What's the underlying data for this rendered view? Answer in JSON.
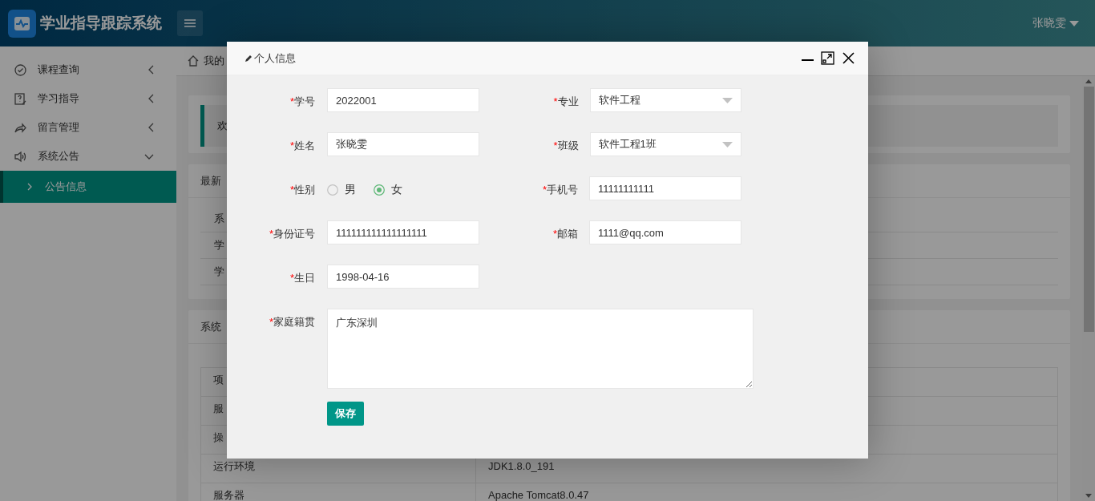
{
  "header": {
    "title": "学业指导跟踪系统",
    "user_name": "张晓雯"
  },
  "sidebar": {
    "items": [
      {
        "label": "课程查询",
        "expanded": false
      },
      {
        "label": "学习指导",
        "expanded": false
      },
      {
        "label": "留言管理",
        "expanded": false
      },
      {
        "label": "系统公告",
        "expanded": true,
        "children": [
          {
            "label": "公告信息",
            "selected": true
          }
        ]
      }
    ]
  },
  "breadcrumb": "我的",
  "welcome": "欢",
  "notices": {
    "title": "最新",
    "rows": [
      "系",
      "学",
      "学"
    ]
  },
  "system_info": {
    "title": "系统",
    "rows": [
      {
        "name": "项"
      },
      {
        "name": "服"
      },
      {
        "name": "操"
      },
      {
        "name": "运行环境",
        "value": "JDK1.8.0_191"
      },
      {
        "name": "服务器",
        "value": "Apache Tomcat8.0.47"
      }
    ]
  },
  "modal": {
    "title": "个人信息",
    "rows": [
      [
        {
          "kind": "text",
          "required_mark": "*",
          "label": "学号",
          "value": "2022001"
        },
        {
          "kind": "select",
          "required_mark": "*",
          "label": "专业",
          "value": "软件工程"
        }
      ],
      [
        {
          "kind": "text",
          "required_mark": "*",
          "label": "姓名",
          "value": "张晓雯"
        },
        {
          "kind": "select",
          "required_mark": "*",
          "label": "班级",
          "value": "软件工程1班"
        }
      ],
      [
        {
          "kind": "radio",
          "required_mark": "*",
          "label": "性别",
          "options": [
            {
              "label": "男",
              "selected": false
            },
            {
              "label": "女",
              "selected": true
            }
          ]
        },
        {
          "kind": "text",
          "required_mark": "*",
          "label": "手机号",
          "value": "11111111111"
        }
      ],
      [
        {
          "kind": "text",
          "required_mark": "*",
          "label": "身份证号",
          "value": "111111111111111111"
        },
        {
          "kind": "text",
          "required_mark": "*",
          "label": "邮箱",
          "value": "1111@qq.com"
        }
      ],
      [
        {
          "kind": "text",
          "required_mark": "*",
          "label": "生日",
          "value": "1998-04-16"
        }
      ],
      [
        {
          "kind": "textarea",
          "required_mark": "*",
          "label": "家庭籍贯",
          "value": "广东深圳"
        }
      ]
    ],
    "save_button": "保存"
  }
}
